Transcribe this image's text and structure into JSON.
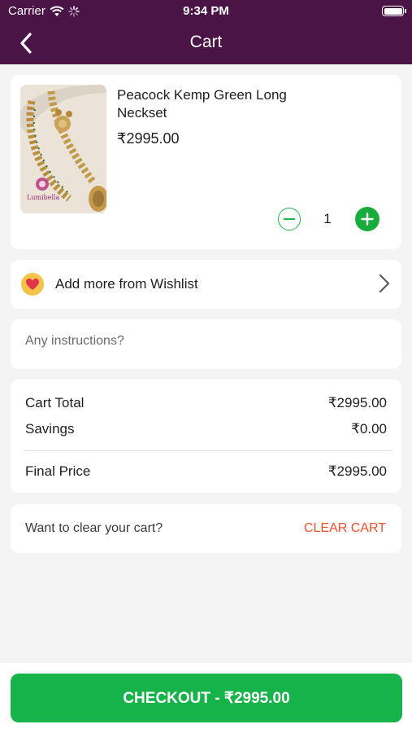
{
  "status_bar": {
    "carrier": "Carrier",
    "time": "9:34 PM"
  },
  "nav": {
    "title": "Cart"
  },
  "cart_item": {
    "name": "Peacock Kemp Green Long Neckset",
    "price": "₹2995.00",
    "quantity": "1",
    "image_brand": "Lumibella"
  },
  "wishlist": {
    "label": "Add more from Wishlist"
  },
  "instructions": {
    "placeholder": "Any instructions?",
    "value": ""
  },
  "totals": {
    "cart_total_label": "Cart Total",
    "cart_total_value": "₹2995.00",
    "savings_label": "Savings",
    "savings_value": "₹0.00",
    "final_label": "Final Price",
    "final_value": "₹2995.00"
  },
  "clear": {
    "question": "Want to clear your cart?",
    "button": "CLEAR CART"
  },
  "checkout": {
    "label": "CHECKOUT - ₹2995.00"
  },
  "colors": {
    "header": "#4a1446",
    "accent_green": "#16b34a",
    "clear_red": "#f2512d",
    "heart_badge": "#f5c24c"
  },
  "icons": [
    "wifi-icon",
    "spinner-icon",
    "battery-icon",
    "back-arrow-icon",
    "minus-circle-icon",
    "plus-circle-icon",
    "heart-icon",
    "chevron-right-icon"
  ]
}
